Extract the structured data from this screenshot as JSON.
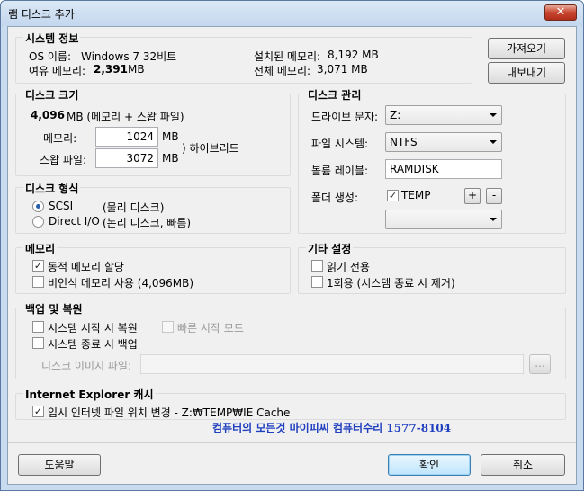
{
  "window": {
    "title": "램 디스크 추가",
    "close_glyph": "✕"
  },
  "system_info": {
    "title": "시스템 정보",
    "os_label": "OS 이름:",
    "os_value": "Windows 7 32비트",
    "free_label": "여유 메모리:",
    "free_value": "2,391",
    "free_unit": "MB",
    "installed_label": "설치된 메모리:",
    "installed_value": "8,192 MB",
    "total_label": "전체 메모리:",
    "total_value": "3,071 MB",
    "import_button": "가져오기",
    "export_button": "내보내기"
  },
  "disk_size": {
    "title": "디스크 크기",
    "summary_value": "4,096",
    "summary_text": "MB (메모리 + 스왑 파일)",
    "memory_label": "메모리:",
    "memory_value": "1024",
    "swap_label": "스왑 파일:",
    "swap_value": "3072",
    "unit": "MB",
    "hybrid_text": ") 하이브리드"
  },
  "disk_type": {
    "title": "디스크 형식",
    "scsi_label": "SCSI",
    "scsi_desc": "(물리 디스크)",
    "directio_label": "Direct I/O",
    "directio_desc": "(논리 디스크, 빠름)"
  },
  "disk_manage": {
    "title": "디스크 관리",
    "drive_label": "드라이브 문자:",
    "drive_value": "Z:",
    "fs_label": "파일 시스템:",
    "fs_value": "NTFS",
    "volume_label": "볼륨 레이블:",
    "volume_value": "RAMDISK",
    "folder_label": "폴더 생성:",
    "folder_value": "TEMP",
    "folder_checked": "✓",
    "add_glyph": "+",
    "remove_glyph": "-"
  },
  "memory": {
    "title": "메모리",
    "dynamic_label": "동적 메모리 할당",
    "dynamic_checked": "✓",
    "unmanaged_label": "비인식 메모리 사용 (4,096MB)"
  },
  "other": {
    "title": "기타 설정",
    "readonly_label": "읽기 전용",
    "once_label": "1회용 (시스템 종료 시 제거)"
  },
  "backup": {
    "title": "백업 및 복원",
    "restore_label": "시스템 시작 시 복원",
    "fast_label": "빠른 시작 모드",
    "backup_label": "시스템 종료 시 백업",
    "image_label": "디스크 이미지 파일:",
    "browse": "..."
  },
  "ie_cache": {
    "title": "Internet Explorer 캐시",
    "change_label": "임시 인터넷 파일 위치 변경 - Z:₩TEMP₩IE Cache",
    "checked": "✓"
  },
  "promo_text": "컴퓨터의 모든것 마이피씨 컴퓨터수리 1577-8104",
  "footer": {
    "help": "도움말",
    "ok": "확인",
    "cancel": "취소"
  }
}
